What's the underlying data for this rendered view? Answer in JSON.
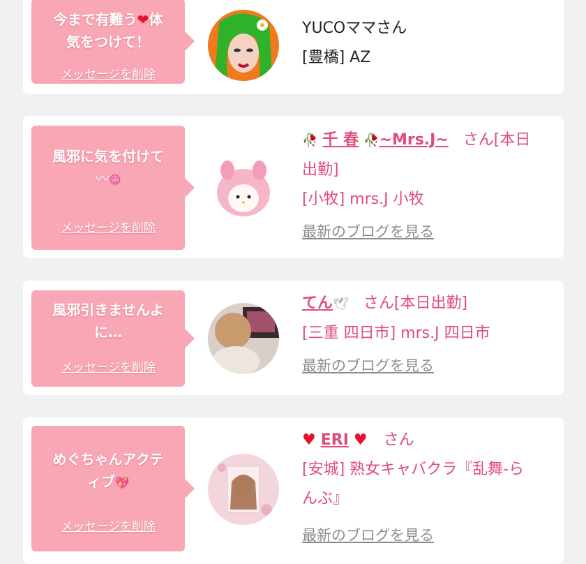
{
  "colors": {
    "background": "#f1f1f1",
    "card": "#ffffff",
    "bubble": "#f9a6b5",
    "link_pink": "#e04c78",
    "blog_gray": "#8c8c8c",
    "heart_red": "#e8102e"
  },
  "cards": [
    {
      "message_line1": "今まで有難う",
      "message_heart": "❤",
      "message_line1b": "体",
      "message_line2": "気をつけて！",
      "delete_label": "メッセージを削除",
      "name": "YUCOママさん",
      "location": "[豊橋] AZ"
    },
    {
      "message_line1": "風邪に気を付けて",
      "message_line2": "〰",
      "message_emoji": "☺",
      "delete_label": "メッセージを削除",
      "name_prefix_icon": "🥀",
      "name": "千 春",
      "name_mid_icon": "🥀",
      "name_suffix": "~Mrs.J~",
      "honorific": "さん[本日",
      "honorific2": "出勤]",
      "location": "[小牧] mrs.J 小牧",
      "blog_link": "最新のブログを見る"
    },
    {
      "message_line1": "風邪引きませんよ",
      "message_line2": "に…",
      "delete_label": "メッセージを削除",
      "name": "てん",
      "name_icon": "🕊",
      "honorific": "さん[本日出勤]",
      "location": "[三重 四日市] mrs.J 四日市",
      "blog_link": "最新のブログを見る"
    },
    {
      "message_line1": "めぐちゃんアクテ",
      "message_line2": "ィブ",
      "message_emoji": "💖",
      "delete_label": "メッセージを削除",
      "name_heart_left": "♥",
      "name": "ERI",
      "name_heart_right": "♥",
      "honorific": "さん",
      "location_line1": "[安城] 熟女キャバクラ『乱舞-ら",
      "location_line2": "んぶ』",
      "blog_link": "最新のブログを見る"
    }
  ]
}
